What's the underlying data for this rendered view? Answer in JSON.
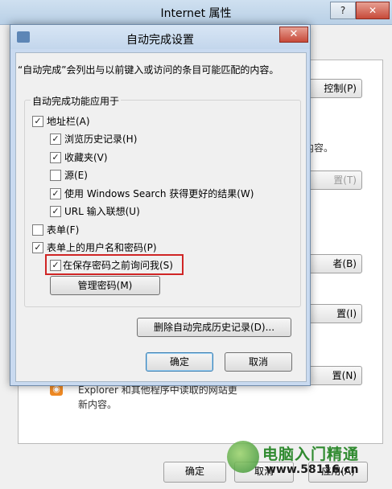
{
  "outer_window": {
    "title": "Internet 属性",
    "help_label": "?",
    "close_label": "✕",
    "buttons": [
      {
        "label": "控制(P)",
        "disabled": false
      },
      {
        "label": "置(T)",
        "disabled": true
      },
      {
        "label": "者(B)",
        "disabled": false
      },
      {
        "label": "置(I)",
        "disabled": false
      },
      {
        "label": "置(N)",
        "disabled": false
      }
    ],
    "text_fragments": [
      "内容。"
    ],
    "feeds_text_line1": "Explorer 和其他程序中读取的网站更",
    "feeds_text_line2": "新内容。",
    "bottom_buttons": {
      "ok": "确定",
      "cancel": "取消",
      "apply": "应用(A)"
    }
  },
  "dialog": {
    "title": "自动完成设置",
    "close_label": "✕",
    "description": "“自动完成”会列出与以前键入或访问的条目可能匹配的内容。",
    "group_label": "自动完成功能应用于",
    "options": [
      {
        "label": "地址栏(A)",
        "checked": true
      },
      {
        "label": "浏览历史记录(H)",
        "checked": true
      },
      {
        "label": "收藏夹(V)",
        "checked": true
      },
      {
        "label": "源(E)",
        "checked": false
      },
      {
        "label": "使用 Windows Search 获得更好的结果(W)",
        "checked": true
      },
      {
        "label": "URL 输入联想(U)",
        "checked": true
      },
      {
        "label": "表单(F)",
        "checked": false
      },
      {
        "label": "表单上的用户名和密码(P)",
        "checked": true
      },
      {
        "label": "在保存密码之前询问我(S)",
        "checked": true
      }
    ],
    "manage_passwords_label": "管理密码(M)",
    "delete_history_label": "删除自动完成历史记录(D)...",
    "ok_label": "确定",
    "cancel_label": "取消"
  },
  "watermark": {
    "title": "电脑入门精通",
    "url": "www.58116.cn"
  },
  "colors": {
    "highlight_border": "#d02525",
    "dialog_frame": "#c9daf0",
    "close_button": "#c74a3a"
  }
}
